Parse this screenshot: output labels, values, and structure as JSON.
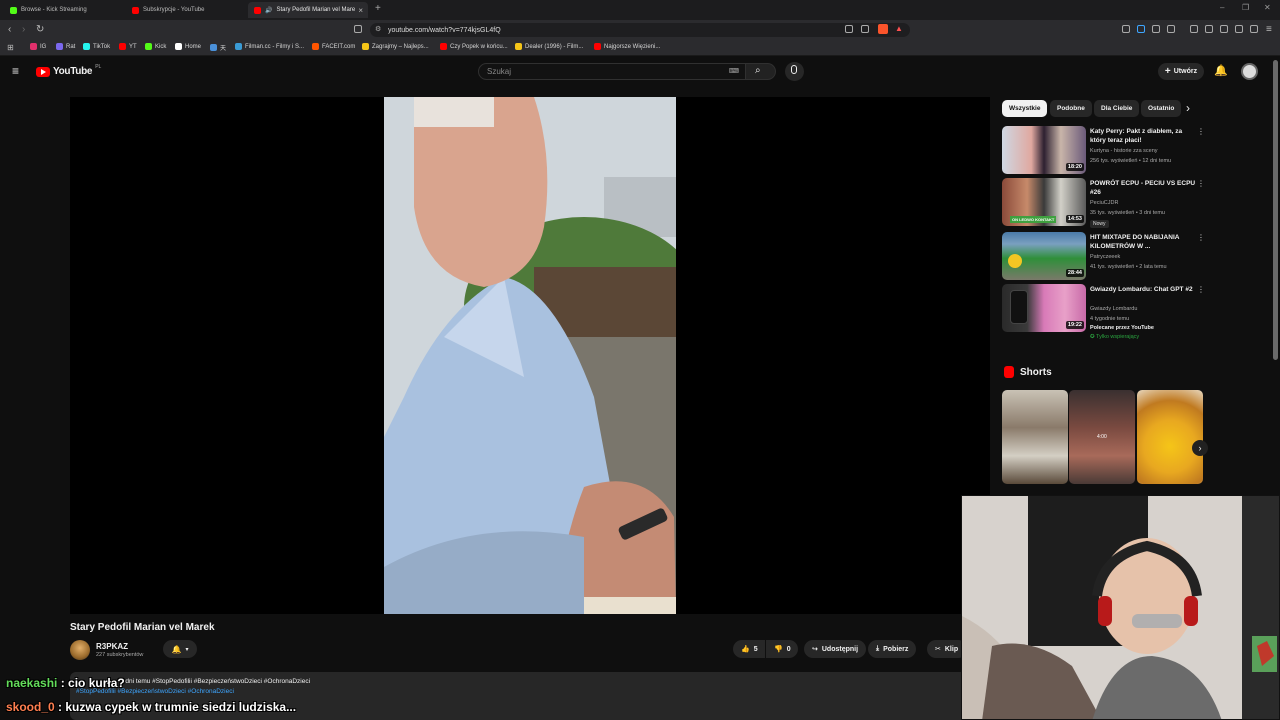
{
  "browser": {
    "tabs": [
      {
        "label": "Browse - Kick Streaming",
        "fav_color": "#53fc18"
      },
      {
        "label": "Subskrypcje - YouTube",
        "fav_color": "#ff0000"
      },
      {
        "label": "Stary Pedofil Marian vel Mare",
        "fav_color": "#ff0000"
      }
    ],
    "url": "youtube.com/watch?v=774kjsGL4fQ",
    "bookmarks": [
      {
        "label": "IG",
        "color": "#e1306c"
      },
      {
        "label": "Rat",
        "color": "#7b68ee"
      },
      {
        "label": "TikTok",
        "color": "#25f4ee"
      },
      {
        "label": "YT",
        "color": "#ff0000"
      },
      {
        "label": "Kick",
        "color": "#53fc18"
      },
      {
        "label": "Home",
        "color": "#ffffff"
      },
      {
        "label": "天",
        "color": "#4a90d9"
      },
      {
        "label": "Filman.cc - Filmy i S...",
        "color": "#3a9bd5"
      },
      {
        "label": "FACEIT.com",
        "color": "#ff5500"
      },
      {
        "label": "Zagrajmy – Najleps...",
        "color": "#f5c518"
      },
      {
        "label": "Czy Popek w końcu...",
        "color": "#ff0000"
      },
      {
        "label": "Dealer (1996) - Film...",
        "color": "#f5c518"
      },
      {
        "label": "Najgorsze Więzieni...",
        "color": "#ff0000"
      }
    ]
  },
  "youtube": {
    "logo_text": "YouTube",
    "logo_region": "PL",
    "search_placeholder": "Szukaj",
    "create_label": "Utwórz"
  },
  "video": {
    "title": "Stary Pedofil Marian vel Marek",
    "channel": "R3PKAZ",
    "subscribers": "227 subskrybentów",
    "likes": "5",
    "dislikes": "0",
    "share_label": "Udostępnij",
    "download_label": "Pobierz",
    "clip_label": "Klip",
    "description_meta": "2 dni temu #StopPedofilii #BezpieczeństwoDzieci #OchronaDzieci",
    "description_tags": "#StopPedofilii #BezpieczeństwoDzieci #OchronaDzieci"
  },
  "chat": [
    {
      "user": "naekashi",
      "user_color": "#63dc5a",
      "message": "cio kurła?"
    },
    {
      "user": "skood_0",
      "user_color": "#ff7f50",
      "message": "kuzwa cypek w trumnie siedzi ludziska..."
    }
  ],
  "sidebar": {
    "chips": [
      "Wszystkie",
      "Podobne",
      "Dla Ciebie",
      "Ostatnio"
    ],
    "recommendations": [
      {
        "title": "Katy Perry: Pakt z diabłem, za który teraz płaci!",
        "channel": "Kurtyna - historie zza sceny",
        "meta": "256 tys. wyświetleń • 12 dni temu",
        "duration": "18:20",
        "badge": "",
        "extra": ""
      },
      {
        "title": "POWRÓT ECPU - PECIU VS ECPU #26",
        "channel": "PeciuCJDR",
        "meta": "35 tys. wyświetleń • 3 dni temu",
        "duration": "14:53",
        "badge": "Nowy",
        "extra": ""
      },
      {
        "title": "HIT MIXTAPE DO NABIJANIA KILOMETRÓW W ...",
        "channel": "Patryczeeek",
        "meta": "41 tys. wyświetleń • 2 lata temu",
        "duration": "28:44",
        "badge": "",
        "extra": ""
      },
      {
        "title": "Gwiazdy Lombardu: Chat GPT #2",
        "channel": "Gwiazdy Lombardu",
        "meta": "4 tygodnie temu",
        "duration": "19:22",
        "badge": "",
        "extra": "Polecane przez YouTube",
        "members": "Tylko wspierający"
      }
    ],
    "shorts_title": "Shorts"
  },
  "colors": {
    "brand_red": "#ff0000",
    "link_blue": "#3ea6ff",
    "background": "#0f0f0f"
  }
}
